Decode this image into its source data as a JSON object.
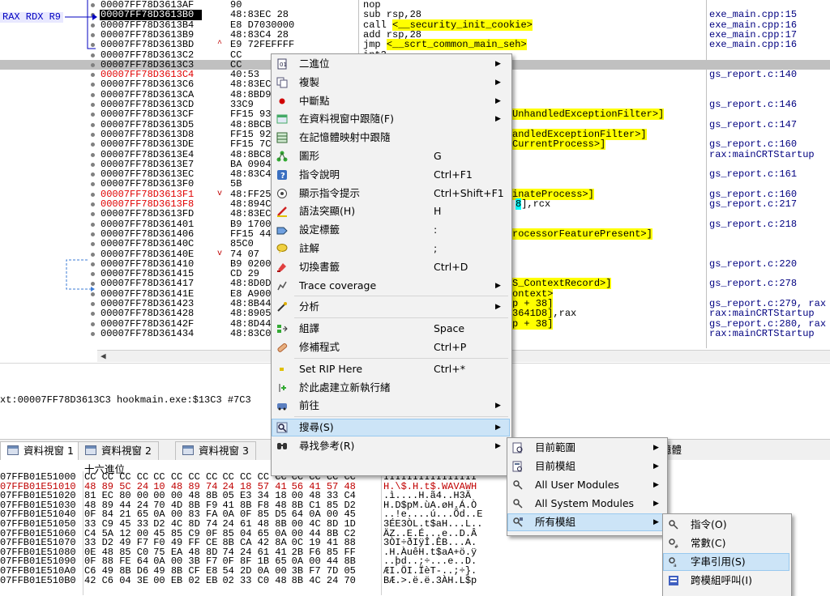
{
  "reg_tag": "RAX RDX R9",
  "disasm": [
    {
      "addr": "00007FF78D3613AF",
      "bytes": "90",
      "instr": [
        [
          "nop",
          ""
        ]
      ],
      "cmt": ""
    },
    {
      "addr": "00007FF78D3613B0",
      "bytes": "48:83EC 28",
      "instr": [
        [
          "sub rsp,28",
          ""
        ]
      ],
      "cmt": "exe_main.cpp:15"
    },
    {
      "addr": "00007FF78D3613B4",
      "bytes": "E8 D7030000",
      "instr": [
        [
          "call ",
          ""
        ],
        [
          "<__security_init_cookie>",
          "hl"
        ]
      ],
      "cmt": "exe_main.cpp:16"
    },
    {
      "addr": "00007FF78D3613B9",
      "bytes": "48:83C4 28",
      "instr": [
        [
          "add rsp,28",
          ""
        ]
      ],
      "cmt": "exe_main.cpp:17"
    },
    {
      "addr": "00007FF78D3613BD",
      "bytes": "E9 72FEFFFF",
      "instr": [
        [
          "jmp ",
          ""
        ],
        [
          "<__scrt_common_main_seh>",
          "hl"
        ]
      ],
      "cmt": "exe_main.cpp:16"
    },
    {
      "addr": "00007FF78D3613C2",
      "bytes": "CC",
      "instr": [
        [
          "int3",
          ""
        ]
      ],
      "cmt": ""
    },
    {
      "addr": "00007FF78D3613C3",
      "bytes": "CC",
      "instr": [],
      "cmt": ""
    },
    {
      "addr": "00007FF78D3613C4",
      "bytes": "40:53",
      "instr": [],
      "cmt": "gs_report.c:140"
    },
    {
      "addr": "00007FF78D3613C6",
      "bytes": "48:83EC",
      "instr": [],
      "cmt": ""
    },
    {
      "addr": "00007FF78D3613CA",
      "bytes": "48:8BD9",
      "instr": [],
      "cmt": ""
    },
    {
      "addr": "00007FF78D3613CD",
      "bytes": "33C9",
      "instr": [],
      "cmt": "gs_report.c:146"
    },
    {
      "addr": "00007FF78D3613CF",
      "bytes": "FF15 93",
      "instr": [
        [
          "UnhandledExceptionFilter>]",
          "hl"
        ]
      ],
      "cmt": ""
    },
    {
      "addr": "00007FF78D3613D5",
      "bytes": "48:8BCB",
      "instr": [],
      "cmt": "gs_report.c:147"
    },
    {
      "addr": "00007FF78D3613D8",
      "bytes": "FF15 92",
      "instr": [
        [
          "andledExceptionFilter>]",
          "hl"
        ]
      ],
      "cmt": ""
    },
    {
      "addr": "00007FF78D3613DE",
      "bytes": "FF15 7C",
      "instr": [
        [
          "CurrentProcess>]",
          "hl"
        ]
      ],
      "cmt": "gs_report.c:160"
    },
    {
      "addr": "00007FF78D3613E4",
      "bytes": "48:8BC8",
      "instr": [],
      "cmt": "rax:mainCRTStartup"
    },
    {
      "addr": "00007FF78D3613E7",
      "bytes": "BA 0904",
      "instr": [],
      "cmt": ""
    },
    {
      "addr": "00007FF78D3613EC",
      "bytes": "48:83C4",
      "instr": [],
      "cmt": "gs_report.c:161"
    },
    {
      "addr": "00007FF78D3613F0",
      "bytes": "5B",
      "instr": [],
      "cmt": ""
    },
    {
      "addr": "00007FF78D3613F1",
      "bytes": "48:FF25",
      "instr": [
        [
          "inateProcess>]",
          "hl"
        ]
      ],
      "cmt": "gs_report.c:160"
    },
    {
      "addr": "00007FF78D3613F8",
      "bytes": "48:894C",
      "instr": [
        [
          "8",
          "cy"
        ],
        [
          "],rcx",
          ""
        ]
      ],
      "cmt": "gs_report.c:217"
    },
    {
      "addr": "00007FF78D3613FD",
      "bytes": "48:83EC",
      "instr": [],
      "cmt": ""
    },
    {
      "addr": "00007FF78D361401",
      "bytes": "B9 1700",
      "instr": [],
      "cmt": "gs_report.c:218"
    },
    {
      "addr": "00007FF78D361406",
      "bytes": "FF15 44",
      "instr": [
        [
          "rocessorFeaturePresent>]",
          "hl"
        ]
      ],
      "cmt": ""
    },
    {
      "addr": "00007FF78D36140C",
      "bytes": "85C0",
      "instr": [],
      "cmt": ""
    },
    {
      "addr": "00007FF78D36140E",
      "bytes": "74 07",
      "instr": [],
      "cmt": ""
    },
    {
      "addr": "00007FF78D361410",
      "bytes": "B9 0200",
      "instr": [],
      "cmt": "gs_report.c:220"
    },
    {
      "addr": "00007FF78D361415",
      "bytes": "CD 29",
      "instr": [],
      "cmt": ""
    },
    {
      "addr": "00007FF78D361417",
      "bytes": "48:8D0D",
      "instr": [
        [
          "S_ContextRecord>]",
          "hl"
        ]
      ],
      "cmt": "gs_report.c:278"
    },
    {
      "addr": "00007FF78D36141E",
      "bytes": "E8 A900",
      "instr": [
        [
          "ontext>",
          "hl"
        ]
      ],
      "cmt": ""
    },
    {
      "addr": "00007FF78D361423",
      "bytes": "48:8B44",
      "instr": [
        [
          "p + 38]",
          "hl"
        ]
      ],
      "cmt": "gs_report.c:279, rax"
    },
    {
      "addr": "00007FF78D361428",
      "bytes": "48:8905",
      "instr": [
        [
          "3641D8]",
          "hl"
        ],
        [
          ",rax",
          ""
        ]
      ],
      "cmt": "rax:mainCRTStartup"
    },
    {
      "addr": "00007FF78D36142F",
      "bytes": "48:8D44",
      "instr": [
        [
          "p + 38]",
          "hl"
        ]
      ],
      "cmt": "gs_report.c:280, rax"
    },
    {
      "addr": "00007FF78D361434",
      "bytes": "48:83C0",
      "instr": [],
      "cmt": "rax:mainCRTStartup"
    }
  ],
  "info_text": "xt:00007FF78D3613C3 hookmain.exe:$13C3 #7C3",
  "tabs": [
    "資料視窗 1",
    "資料視窗 2",
    "資料視窗 3",
    "憶體"
  ],
  "dump_header": "十六進位",
  "dump": [
    {
      "addr": "07FFB01E51000",
      "hex": [
        "CC CC CC CC",
        "CC CC CC CC",
        "CC CC CC CC",
        "CC CC CC CC"
      ],
      "asc": "ÌÌÌÌÌÌÌÌÌÌÌÌÌÌÌÌ"
    },
    {
      "addr": "07FFB01E51010",
      "hex": [
        "48 89 5C 24",
        "10 48 89 74",
        "24 18 57 41",
        "56 41 57 48"
      ],
      "asc": "H.\\$.H.t$.WAVAWH",
      "red": true
    },
    {
      "addr": "07FFB01E51020",
      "hex": [
        "81 EC 80 00",
        "00 00 48 8B",
        "05 E3 34 18",
        "00 48 33 C4"
      ],
      "asc": ".ì....H.ã4..H3Ä"
    },
    {
      "addr": "07FFB01E51030",
      "hex": [
        "48 89 44 24",
        "70 4D 8B F9",
        "41 8B F8 48",
        "8B C1 85 D2"
      ],
      "asc": "H.D$pM.ùA.øH.Á.Ò"
    },
    {
      "addr": "07FFB01E51040",
      "hex": [
        "0F 84 21 65",
        "0A 00 83 FA",
        "0A 0F 85 D5",
        "64 0A 00 45"
      ],
      "asc": "..!e....ú...Õd..E"
    },
    {
      "addr": "07FFB01E51050",
      "hex": [
        "33 C9 45 33",
        "D2 4C 8D 74",
        "24 61 48 8B",
        "00 4C 8D 1D"
      ],
      "asc": "3ÉE3ÒL.t$aH...L.."
    },
    {
      "addr": "07FFB01E51060",
      "hex": [
        "C4 5A 12 00",
        "45 85 C9 0F",
        "85 04 65 0A",
        "00 44 8B C2"
      ],
      "asc": "ÄZ..E.É...e..D.Â"
    },
    {
      "addr": "07FFB01E51070",
      "hex": [
        "33 D2 49 F7",
        "F0 49 FF CE",
        "8B CA 42 8A",
        "0C 19 41 88"
      ],
      "asc": "3ÒI÷ðIÿÎ.ÊB...A."
    },
    {
      "addr": "07FFB01E51080",
      "hex": [
        "0E 48 85 C0",
        "75 EA 48 8D",
        "74 24 61 41",
        "2B F6 85 FF"
      ],
      "asc": ".H.ÀuêH.t$aA+ö.ÿ"
    },
    {
      "addr": "07FFB01E51090",
      "hex": [
        "0F 88 FE 64",
        "0A 00 3B F7",
        "0F 8F 1B 65",
        "0A 00 44 8B"
      ],
      "asc": "..þd..;÷...e..D."
    },
    {
      "addr": "07FFB01E510A0",
      "hex": [
        "C6 49 8B D6",
        "49 8B CF E8",
        "54 2D 0A 00",
        "3B F7 7D 05"
      ],
      "asc": "ÆI.ÖI.ÏèT-..;÷}."
    },
    {
      "addr": "07FFB01E510B0",
      "hex": [
        "42 C6 04 3E",
        "00 EB 02 EB",
        "02 33 C0 48",
        "8B 4C 24 70"
      ],
      "asc": "BÆ.>.ë.ë.3ÀH.L$p"
    }
  ],
  "context_menu": [
    {
      "label": "二進位",
      "key": "",
      "arrow": true,
      "icon": "binary-icon",
      "sepBefore": false
    },
    {
      "label": "複製",
      "key": "",
      "arrow": true,
      "icon": "copy-icon",
      "sepBefore": false
    },
    {
      "label": "中斷點",
      "key": "",
      "arrow": true,
      "icon": "breakpoint-icon",
      "sepBefore": false
    },
    {
      "label": "在資料視窗中跟隨(F)",
      "key": "",
      "arrow": true,
      "icon": "follow-dump-icon",
      "sepBefore": false
    },
    {
      "label": "在記憶體映射中跟隨",
      "key": "",
      "arrow": false,
      "icon": "memory-map-icon",
      "sepBefore": false
    },
    {
      "label": "圖形",
      "key": "G",
      "arrow": false,
      "icon": "graph-icon",
      "sepBefore": false
    },
    {
      "label": "指令說明",
      "key": "Ctrl+F1",
      "arrow": false,
      "icon": "help-icon",
      "sepBefore": false
    },
    {
      "label": "顯示指令提示",
      "key": "Ctrl+Shift+F1",
      "arrow": false,
      "icon": "hint-icon",
      "sepBefore": false
    },
    {
      "label": "語法突顯(H)",
      "key": "H",
      "arrow": false,
      "icon": "highlight-icon",
      "sepBefore": false
    },
    {
      "label": "設定標籤",
      "key": ":",
      "arrow": false,
      "icon": "label-icon",
      "sepBefore": false
    },
    {
      "label": "註解",
      "key": ";",
      "arrow": false,
      "icon": "comment-icon",
      "sepBefore": false
    },
    {
      "label": "切換書籤",
      "key": "Ctrl+D",
      "arrow": false,
      "icon": "bookmark-icon",
      "sepBefore": false
    },
    {
      "label": "Trace coverage",
      "key": "",
      "arrow": true,
      "icon": "trace-icon",
      "sepBefore": false
    },
    {
      "label": "分析",
      "key": "",
      "arrow": true,
      "icon": "analysis-icon",
      "sepBefore": true
    },
    {
      "label": "組譯",
      "key": "Space",
      "arrow": false,
      "icon": "assemble-icon",
      "sepBefore": true
    },
    {
      "label": "修補程式",
      "key": "Ctrl+P",
      "arrow": false,
      "icon": "patch-icon",
      "sepBefore": false
    },
    {
      "label": "Set RIP Here",
      "key": "Ctrl+*",
      "arrow": false,
      "icon": "set-rip-icon",
      "sepBefore": true
    },
    {
      "label": "於此處建立新執行緒",
      "key": "",
      "arrow": false,
      "icon": "new-thread-icon",
      "sepBefore": false
    },
    {
      "label": "前往",
      "key": "",
      "arrow": true,
      "icon": "goto-icon",
      "sepBefore": false
    },
    {
      "label": "搜尋(S)",
      "key": "",
      "arrow": true,
      "icon": "search-icon",
      "sepBefore": true,
      "hot": true
    },
    {
      "label": "尋找參考(R)",
      "key": "",
      "arrow": true,
      "icon": "find-references-icon",
      "sepBefore": false
    }
  ],
  "search_menu": [
    {
      "label": "目前範圍",
      "arrow": true,
      "icon": "current-region-icon"
    },
    {
      "label": "目前模組",
      "arrow": true,
      "icon": "current-module-icon"
    },
    {
      "label": "All User Modules",
      "arrow": true,
      "icon": "user-modules-icon"
    },
    {
      "label": "All System Modules",
      "arrow": true,
      "icon": "system-modules-icon"
    },
    {
      "label": "所有模組",
      "arrow": true,
      "icon": "all-modules-icon",
      "hot": true
    }
  ],
  "modules_menu": [
    {
      "label": "指令(O)",
      "icon": "search-command-icon"
    },
    {
      "label": "常數(C)",
      "icon": "search-constant-icon"
    },
    {
      "label": "字串引用(S)",
      "icon": "search-string-icon",
      "hot": true
    },
    {
      "label": "跨模組呼叫(I)",
      "icon": "intermodular-call-icon"
    }
  ]
}
